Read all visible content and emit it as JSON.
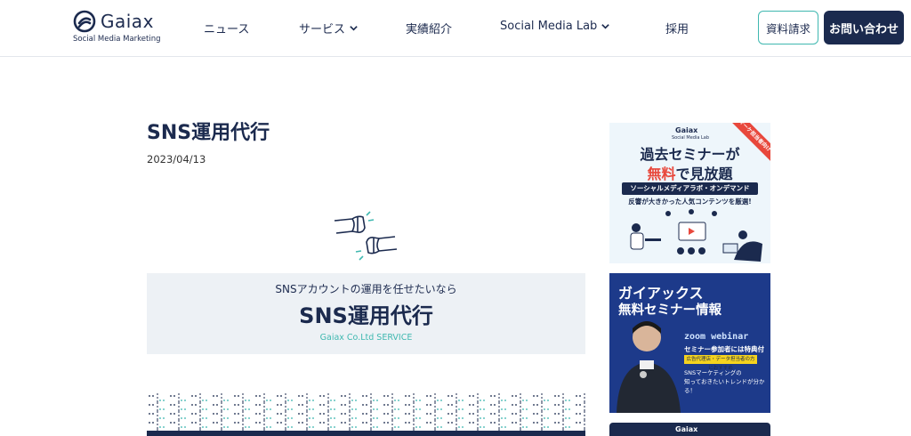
{
  "header": {
    "logo": {
      "name": "Gaiax",
      "subtitle": "Social Media Marketing"
    },
    "nav": [
      {
        "label": "ニュース",
        "has_dropdown": false
      },
      {
        "label": "サービス",
        "has_dropdown": true
      },
      {
        "label": "実績紹介",
        "has_dropdown": false
      },
      {
        "label": "Social Media Lab",
        "has_dropdown": true
      },
      {
        "label": "採用",
        "has_dropdown": false
      }
    ],
    "docs_button": "資料請求",
    "contact_button": "お問い合わせ"
  },
  "article": {
    "title": "SNS運用代行",
    "date": "2023/04/13",
    "hero": {
      "subtitle": "SNSアカウントの運用を任せたいなら",
      "title": "SNS運用代行",
      "company": "Gaiax Co.Ltd SERVICE"
    }
  },
  "sidebar": {
    "banner1": {
      "logo": "Gaiax",
      "logo_sub": "Social Media Lab",
      "ribbon": "マーケ担当者向け",
      "line1": "過去セミナーが",
      "line2_accent": "無料",
      "line2_rest": "で見放題",
      "pill": "ソーシャルメディアラボ・オンデマンド",
      "desc": "反響が大きかった人気コンテンツを厳選!"
    },
    "banner2": {
      "title1": "ガイアックス",
      "title2": "無料セミナー情報",
      "zoom": "zoom webinar",
      "bonus": "セミナー参加者には特典付き",
      "tag": "広告代理店・データ担当者の方におすすめ",
      "desc1": "SNSマーケティングの",
      "desc2": "知っておきたいトレンドが分かる！"
    },
    "banner3": {
      "logo": "Gaiax"
    }
  },
  "colors": {
    "navy": "#1b2a4e",
    "teal": "#3fb8b0",
    "red": "#e8483c",
    "hero_bg": "#edf1f5"
  }
}
